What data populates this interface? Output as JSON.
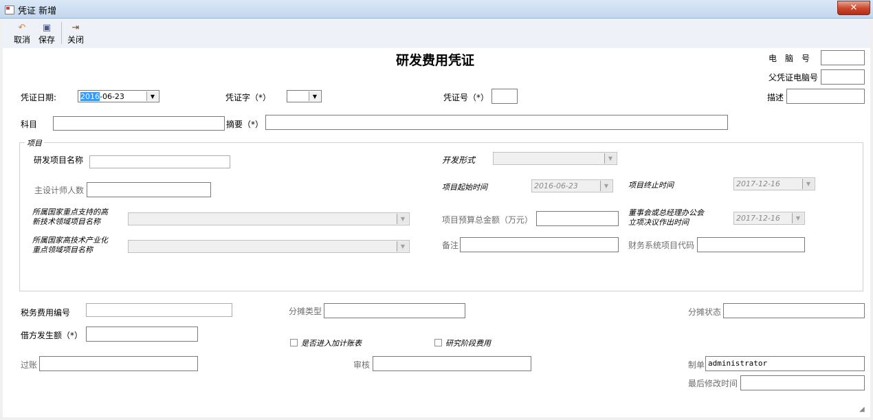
{
  "window": {
    "title": "凭证 新增",
    "close": "✕"
  },
  "toolbar": {
    "cancel": "取消",
    "save": "保存",
    "close": "关闭"
  },
  "form": {
    "heading": "研发费用凭证",
    "computer_no": "电　脑　号",
    "parent_computer_no": "父凭证电脑号",
    "date_label": "凭证日期:",
    "date_highlight": "2016",
    "date_rest": "-06-23",
    "voucher_word": "凭证字（*）",
    "voucher_no": "凭证号（*）",
    "desc": "描述",
    "subject": "科目",
    "summary": "摘要（*）"
  },
  "project": {
    "group": "项目",
    "name": "研发项目名称",
    "dev_form": "开发形式",
    "designers": "主设计师人数",
    "start_time": "项目起始时间",
    "start_value": "2016-06-23",
    "end_time": "项目终止时间",
    "end_value": "2017-12-16",
    "hitech_l1": "所属国家重点支持的高",
    "hitech_l2": "新技术领域项目名称",
    "budget": "项目预算总金额（万元）",
    "board_l1": "董事会或总经理办公会",
    "board_l2": "立项决议作出时间",
    "board_value": "2017-12-16",
    "industry_l1": "所属国家高技术产业化",
    "industry_l2": "重点领域项目名称",
    "remark": "备注",
    "finance_code": "财务系统项目代码"
  },
  "bottom": {
    "tax_no": "税务费用编号",
    "alloc_type": "分摊类型",
    "alloc_status": "分摊状态",
    "debit": "借方发生额（*）",
    "extra_deduct": "是否进入加计账表",
    "research_phase": "研究阶段费用",
    "posted": "过账",
    "audit": "审核",
    "maker": "制单",
    "maker_value": "administrator",
    "last_modified": "最后修改时间"
  }
}
